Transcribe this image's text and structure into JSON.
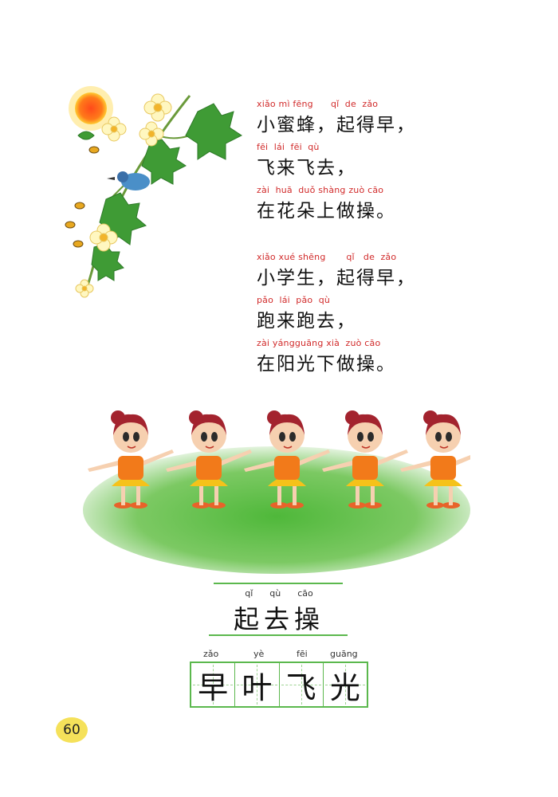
{
  "poem": {
    "stanza1": [
      {
        "pinyin": "xiǎo mì fēng      qǐ  de  zǎo",
        "text": "小蜜蜂，起得早，"
      },
      {
        "pinyin": "fēi  lái  fēi  qù",
        "text": "飞来飞去，"
      },
      {
        "pinyin": "zài  huā  duǒ shàng zuò cāo",
        "text": "在花朵上做操。"
      }
    ],
    "stanza2": [
      {
        "pinyin": "xiǎo xué shēng       qǐ   de  zǎo",
        "text": "小学生，起得早，"
      },
      {
        "pinyin": "pǎo  lái  pǎo  qù",
        "text": "跑来跑去，"
      },
      {
        "pinyin": "zài yángguāng xià  zuò cāo",
        "text": "在阳光下做操。"
      }
    ]
  },
  "title": {
    "pinyin": "qǐ      qù      cāo",
    "text": "起去操"
  },
  "words": {
    "pinyin": [
      "zǎo",
      "yè",
      "fēi",
      "guāng"
    ],
    "chars": [
      "早",
      "叶",
      "飞",
      "光"
    ]
  },
  "page_number": "60",
  "colors": {
    "pinyin": "#d12a2a",
    "grid": "#5bb84d",
    "page_badge": "#f5e15a"
  }
}
